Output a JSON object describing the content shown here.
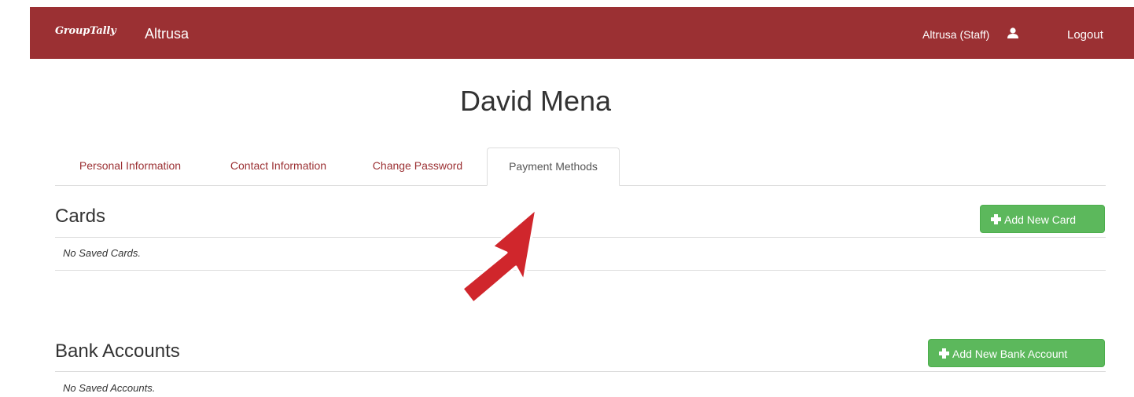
{
  "header": {
    "brand": "GroupTally",
    "org_name": "Altrusa",
    "user_label": "Altrusa (Staff)",
    "logout_label": "Logout",
    "bg_color": "#9b3033"
  },
  "profile": {
    "name": "David Mena"
  },
  "tabs": [
    {
      "label": "Personal Information",
      "active": false
    },
    {
      "label": "Contact Information",
      "active": false
    },
    {
      "label": "Change Password",
      "active": false
    },
    {
      "label": "Payment Methods",
      "active": true
    }
  ],
  "cards": {
    "heading": "Cards",
    "button_label": "Add New Card",
    "empty_text": "No Saved Cards."
  },
  "bank_accounts": {
    "heading": "Bank Accounts",
    "button_label": "Add New Bank Account",
    "empty_text": "No Saved Accounts."
  },
  "annotation": {
    "arrow_color": "#d0262c",
    "points_to": "tab-payment-methods"
  },
  "colors": {
    "accent": "#9b3033",
    "success": "#5cb85c"
  }
}
